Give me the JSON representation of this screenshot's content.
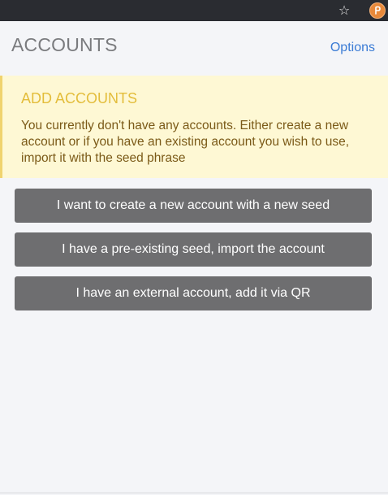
{
  "browser": {
    "icons": [
      "star-icon",
      "polkadot-extension-icon"
    ],
    "ext_color": "#e8893a"
  },
  "header": {
    "title": "ACCOUNTS",
    "options_label": "Options"
  },
  "alert": {
    "title": "ADD ACCOUNTS",
    "body": "You currently don't have any accounts. Either create a new account or if you have an existing account you wish to use, import it with the seed phrase"
  },
  "actions": {
    "create_label": "I want to create a new account with a new seed",
    "import_label": "I have a pre-existing seed, import the account",
    "external_label": "I have an external account, add it via QR"
  },
  "colors": {
    "accent": "#3a7bd5",
    "alert_bg": "#fef8d4",
    "alert_title": "#e3bd3b",
    "button_bg": "#6e6e70"
  }
}
